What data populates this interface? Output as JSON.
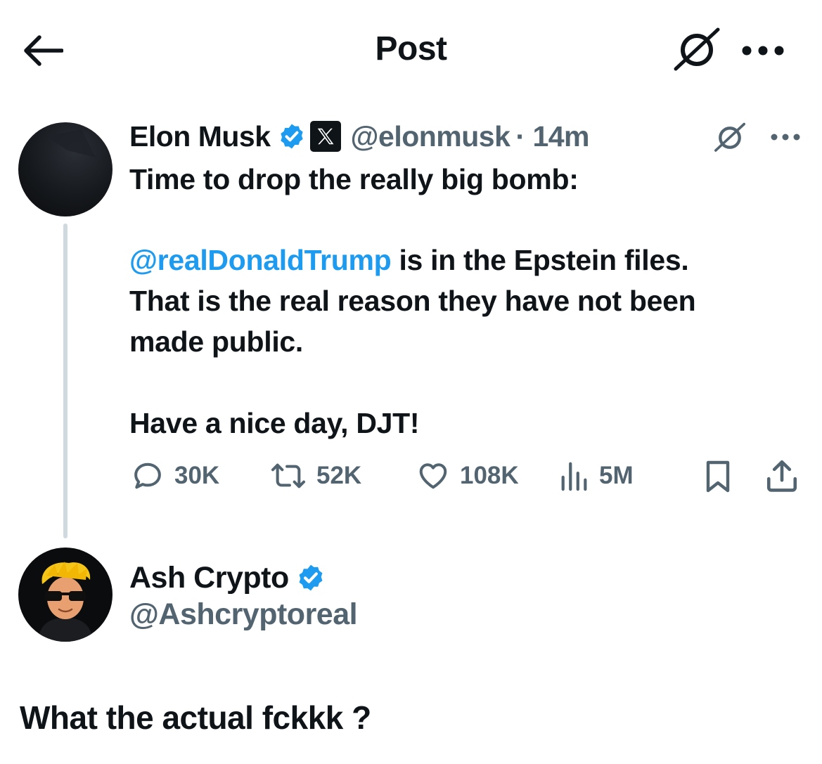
{
  "header": {
    "title": "Post",
    "back_icon": "arrow-left-icon",
    "grok_icon": "grok-icon",
    "more_icon": "more-dots-icon"
  },
  "post": {
    "author": {
      "name": "Elon Musk",
      "handle": "@elonmusk",
      "time": "· 14m",
      "verified": true,
      "affiliate_badge": "x-logo-icon"
    },
    "text_line1": "Time to drop the really big bomb:",
    "mention": "@realDonaldTrump",
    "text_after_mention": " is in the Epstein files.",
    "text_line3": "That is the real reason they have not been",
    "text_line4": "made public.",
    "text_line5": "Have a nice day, DJT!",
    "actions": {
      "replies": "30K",
      "reposts": "52K",
      "likes": "108K",
      "views": "5M"
    }
  },
  "quoting_user": {
    "name": "Ash Crypto",
    "handle": "@Ashcryptoreal",
    "verified": true
  },
  "reply_text": "What the actual fckkk ?",
  "colors": {
    "accent": "#1d9bf0",
    "muted": "#536471",
    "text": "#0f1419",
    "thread_line": "#cfd9de"
  }
}
